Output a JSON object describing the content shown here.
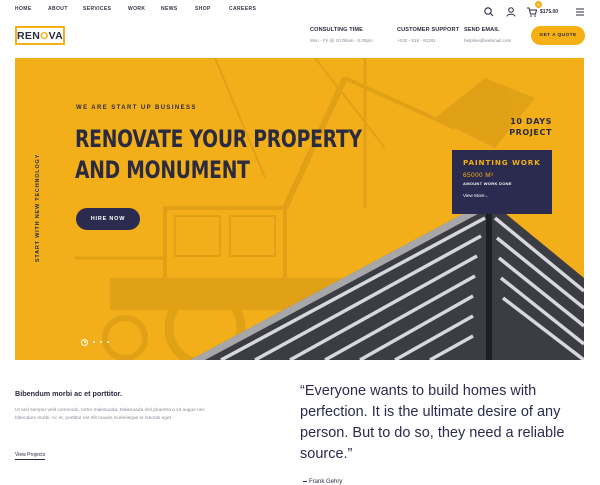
{
  "nav": {
    "items": [
      "HOME",
      "ABOUT",
      "SERVICES",
      "WORK",
      "NEWS",
      "SHOP",
      "CAREERS"
    ],
    "cart_count": "0",
    "cart_total": "$175.00",
    "icons": [
      "search-icon",
      "user-icon",
      "cart-icon",
      "menu-icon"
    ]
  },
  "header": {
    "logo_part1": "REN",
    "logo_part2": "O",
    "logo_part3": "VA",
    "info": [
      {
        "title": "CONSULTING TIME",
        "value": "Mon - Fri @ 10.00am - 5.00pm"
      },
      {
        "title": "CUSTOMER SUPPORT",
        "value": "+102 - 918 - 91291"
      },
      {
        "title": "SEND EMAIL",
        "value": "helpline@webmail.com"
      }
    ],
    "quote_button": "GET A QUOTE"
  },
  "hero": {
    "vertical_text": "START WITH NEW TECHNOLOGY",
    "eyebrow": "WE ARE START UP BUSINESS",
    "title_line1": "RENOVATE YOUR PROPERTY",
    "title_line2": "AND MONUMENT",
    "button": "HIRE NOW",
    "days_line1": "10 DAYS",
    "days_line2": "PROJECT",
    "card": {
      "title": "PAINTING WORK",
      "area": "65000 M²",
      "subtitle": "AMOUNT WORK DONE",
      "link": "View More..."
    },
    "slide_count": 4,
    "active_slide": 1
  },
  "about": {
    "title": "Bibendum morbi ac et porttitor.",
    "text": "Ut sed semper velit commodo, tortor malesuada. Malesuada nisl pharetra a sit augue nec bibendum morbi. Ac et, porttitor est elit mauris scelerisque et lobortis eget.",
    "link": "View Projects"
  },
  "quote": {
    "text": "“Everyone wants to build homes with perfection. It is the ultimate desire of any person. But to do so, they need a reliable source.”",
    "author": "Frank Gehry"
  },
  "colors": {
    "accent": "#f4b014",
    "navy": "#2b2b4f"
  }
}
